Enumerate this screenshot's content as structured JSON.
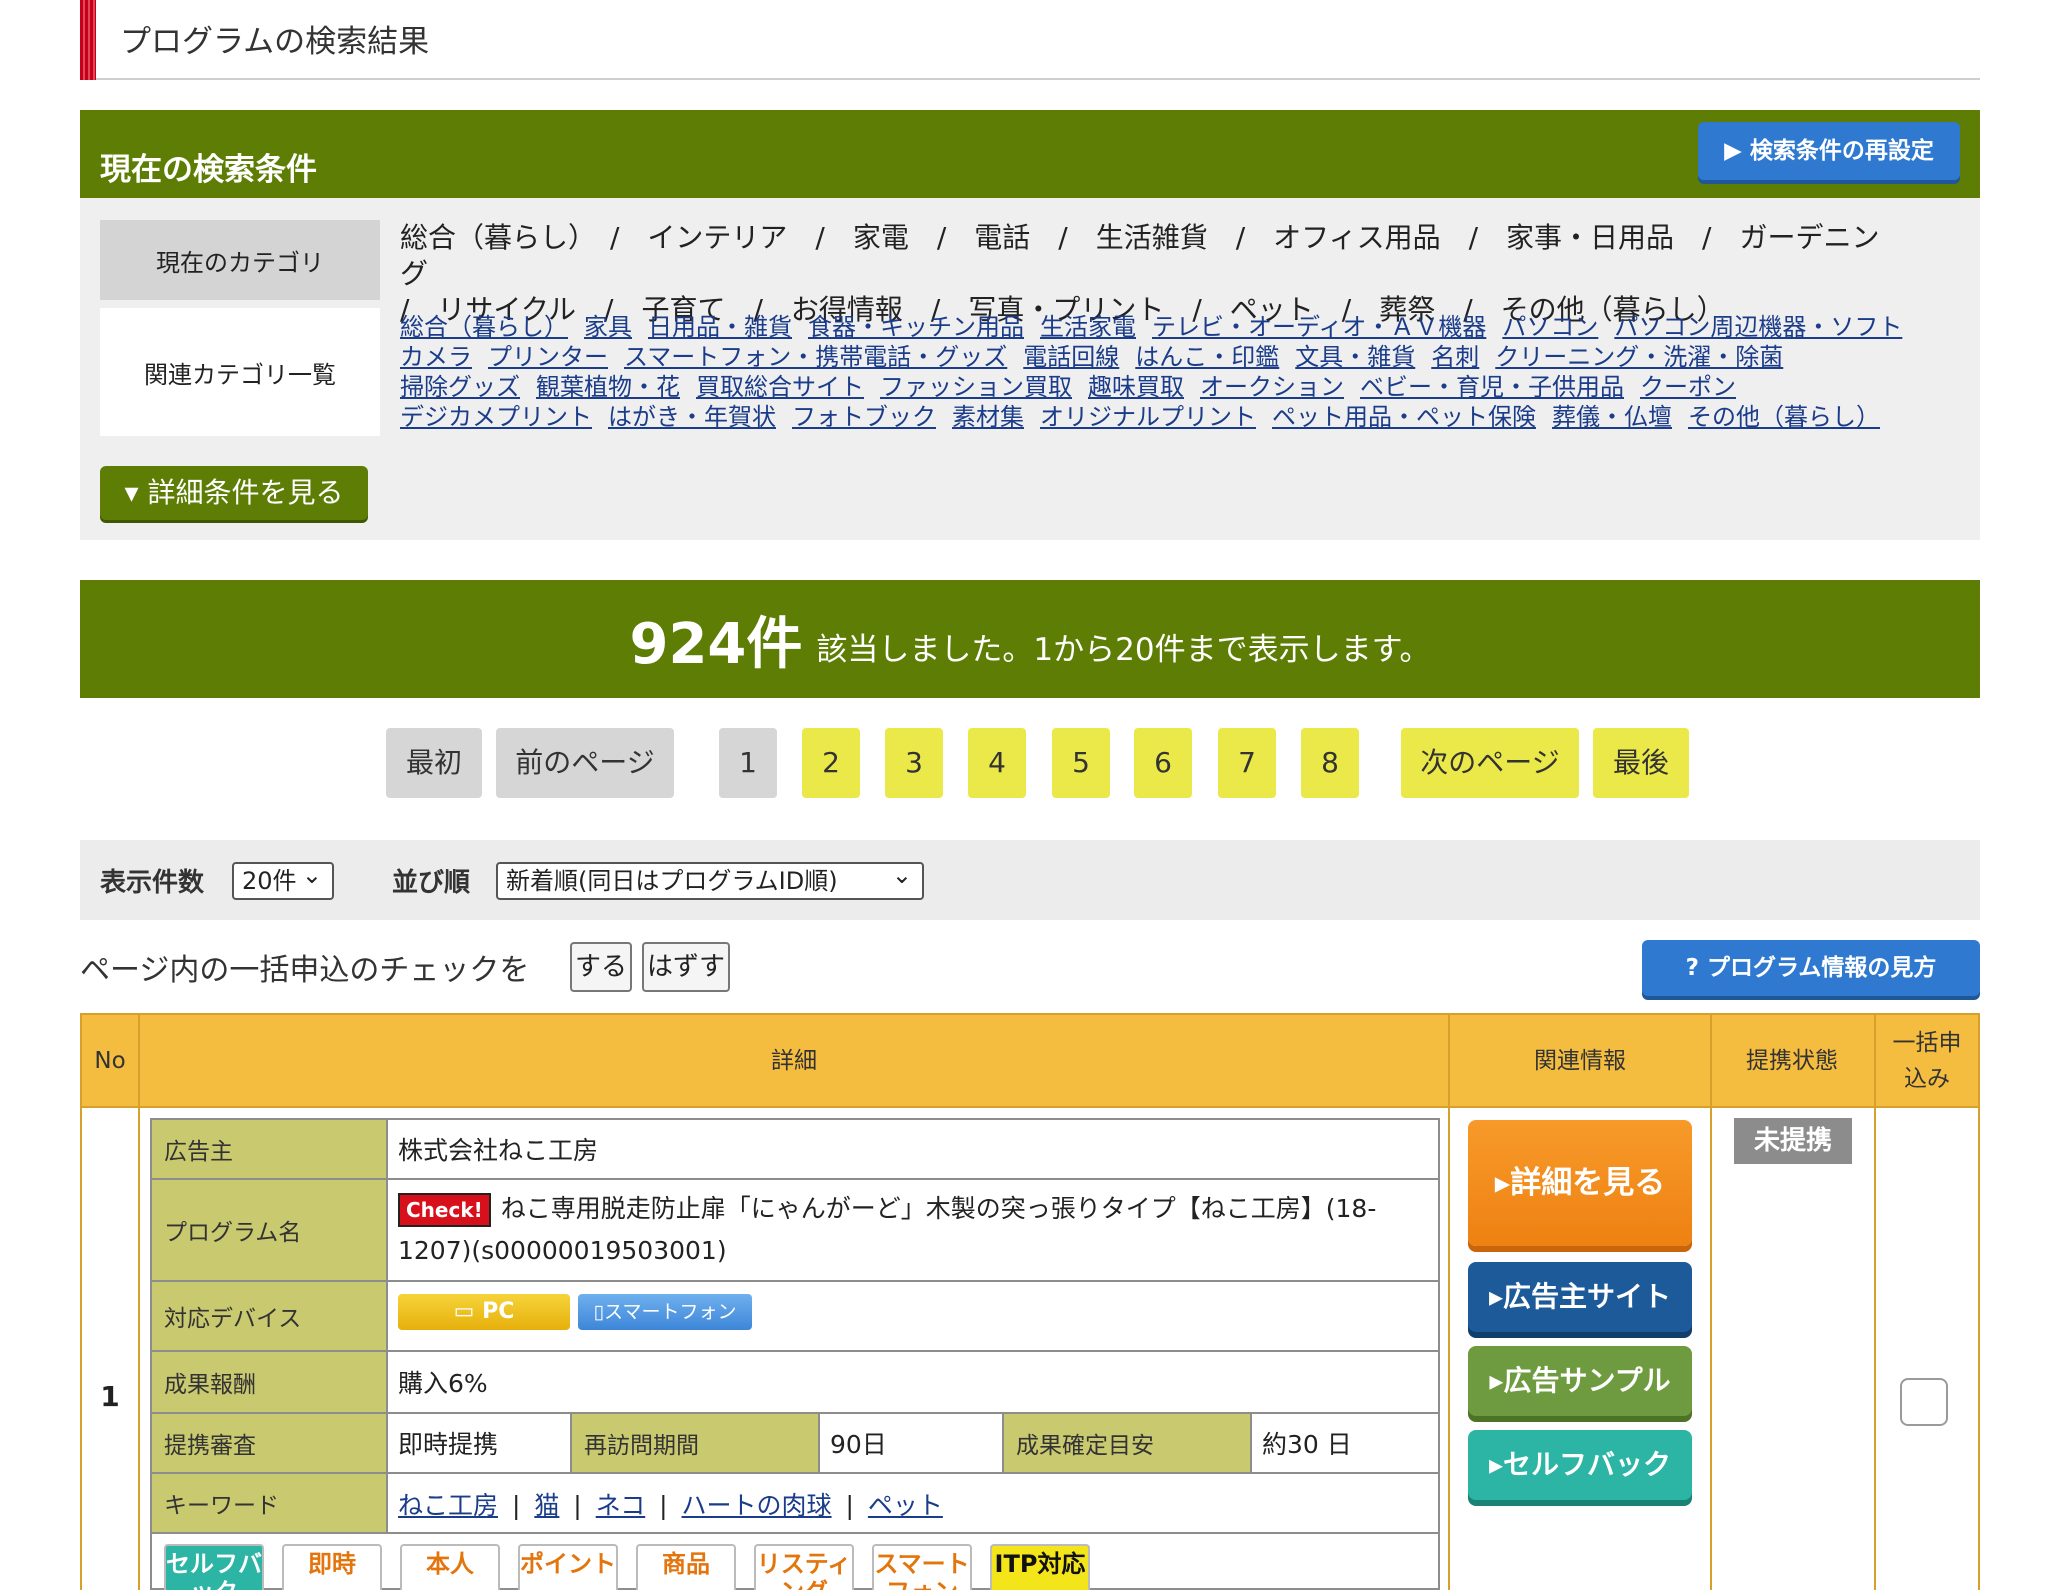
{
  "page_title": "プログラムの検索結果",
  "conditions": {
    "header": "現在の検索条件",
    "reset_button": "▶ 検索条件の再設定",
    "category_label": "現在のカテゴリ",
    "current_categories_line1": "総合（暮らし）　/　インテリア　/　家電　/　電話　/　生活雑貨　/　オフィス用品　/　家事・日用品　/　ガーデニング",
    "current_categories_line2": "/　リサイクル　/　子育て　/　お得情報　/　写真・プリント　/　ペット　/　葬祭　/　その他（暮らし）",
    "related_label": "関連カテゴリ一覧",
    "related": [
      [
        "総合（暮らし）",
        "家具",
        "日用品・雑貨",
        "食器・キッチン用品",
        "生活家電",
        "テレビ・オーディオ・ＡＶ機器",
        "パソコン",
        "パソコン周辺機器・ソフト"
      ],
      [
        "カメラ",
        "プリンター",
        "スマートフォン・携帯電話・グッズ",
        "電話回線",
        "はんこ・印鑑",
        "文具・雑貨",
        "名刺",
        "クリーニング・洗濯・除菌"
      ],
      [
        "掃除グッズ",
        "観葉植物・花",
        "買取総合サイト",
        "ファッション買取",
        "趣味買取",
        "オークション",
        "ベビー・育児・子供用品",
        "クーポン"
      ],
      [
        "デジカメプリント",
        "はがき・年賀状",
        "フォトブック",
        "素材集",
        "オリジナルプリント",
        "ペット用品・ペット保険",
        "葬儀・仏壇",
        "その他（暮らし）"
      ]
    ],
    "detail_toggle": "▾ 詳細条件を見る"
  },
  "result": {
    "count": "924件",
    "text": "該当しました。1から20件まで表示します。"
  },
  "pagination": {
    "first": "最初",
    "prev": "前のページ",
    "next": "次のページ",
    "last": "最後",
    "pages": [
      "1",
      "2",
      "3",
      "4",
      "5",
      "6",
      "7",
      "8"
    ],
    "current": "1"
  },
  "options": {
    "per_page_label": "表示件数",
    "per_page_value": "20件",
    "sort_label": "並び順",
    "sort_value": "新着順(同日はプログラムID順)"
  },
  "bulk": {
    "text": "ページ内の一括申込のチェックを",
    "on": "する",
    "off": "はずす",
    "howto": "? プログラム情報の見方"
  },
  "table": {
    "headers": {
      "no": "No",
      "detail": "詳細",
      "related": "関連情報",
      "status": "提携状態",
      "bulk": "一括申込み"
    },
    "row": {
      "no": "1",
      "advertiser_label": "広告主",
      "advertiser": "株式会社ねこ工房",
      "program_label": "プログラム名",
      "check_badge": "Check!",
      "program_name": "ねこ専用脱走防止扉「にゃんがーど」木製の突っ張りタイプ【ねこ工房】(18-1207)(s00000019503001)",
      "device_label": "対応デバイス",
      "device_pc": "PC",
      "device_sp": "スマートフォン",
      "reward_label": "成果報酬",
      "reward": "購入6%",
      "review_label": "提携審査",
      "review": "即時提携",
      "revisit_label": "再訪問期間",
      "revisit": "90日",
      "confirm_label": "成果確定目安",
      "confirm": "約30 日",
      "keyword_label": "キーワード",
      "keywords": [
        "ねこ工房",
        "猫",
        "ネコ",
        "ハートの肉球",
        "ペット"
      ],
      "tags": [
        "セルフバック",
        "即時",
        "本人",
        "ポイント",
        "商品",
        "リスティング",
        "スマートフォン",
        "ITP対応"
      ],
      "status": "未提携",
      "btn_detail": "▸詳細を見る",
      "btn_site": "▸広告主サイト",
      "btn_sample": "▸広告サンプル",
      "btn_self": "▸セルフバック"
    }
  },
  "colors": {
    "green": "#5e7d05",
    "blue": "#2f7ad0",
    "orange_header": "#f5bd3f",
    "olive_label": "#c9c970",
    "page_yellow": "#ebe94a"
  }
}
